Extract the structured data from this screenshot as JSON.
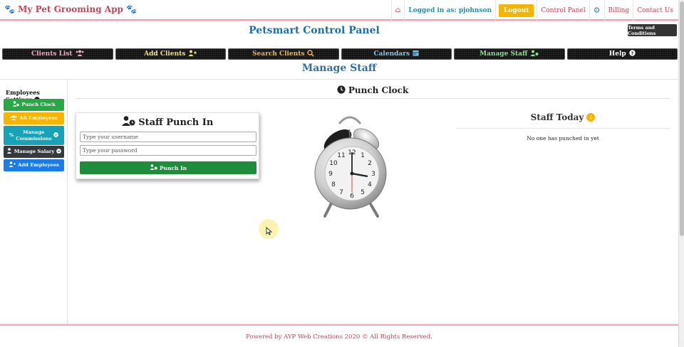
{
  "header": {
    "brand": "My Pet Grooming App",
    "logged_in": "Logged in as: pjohnson",
    "logout": "Logout",
    "control_panel": "Control Panel",
    "billing": "Billing",
    "contact": "Contact Us"
  },
  "panel": {
    "title": "Petsmart Control Panel",
    "terms": "Terms and Conditions"
  },
  "nav": {
    "clients_list": "Clients List",
    "add_clients": "Add Clients",
    "search_clients": "Search Clients",
    "calendars": "Calendars",
    "manage_staff": "Manage Staff",
    "help": "Help"
  },
  "page": {
    "title": "Manage Staff"
  },
  "sidebar": {
    "heading": "Employees Settings",
    "items": [
      {
        "label": "Punch Clock"
      },
      {
        "label": "All Employees"
      },
      {
        "label": "Manage Commissions"
      },
      {
        "label": "Manage Salary"
      },
      {
        "label": "Add Employees"
      }
    ]
  },
  "punch_clock": {
    "section_title": "Punch Clock",
    "card_title": "Staff Punch In",
    "username_placeholder": "Type your username",
    "password_placeholder": "Type your password",
    "button": "Punch In"
  },
  "staff_today": {
    "title": "Staff Today",
    "empty": "No one has punched in yet"
  },
  "footer": {
    "text": "Powered by AYP Web Creations 2020 © All Rights Reserved."
  },
  "colors": {
    "brand": "#c0475a",
    "primary_blue": "#1d6fa5",
    "logout": "#f4b400",
    "green": "#28a745"
  }
}
